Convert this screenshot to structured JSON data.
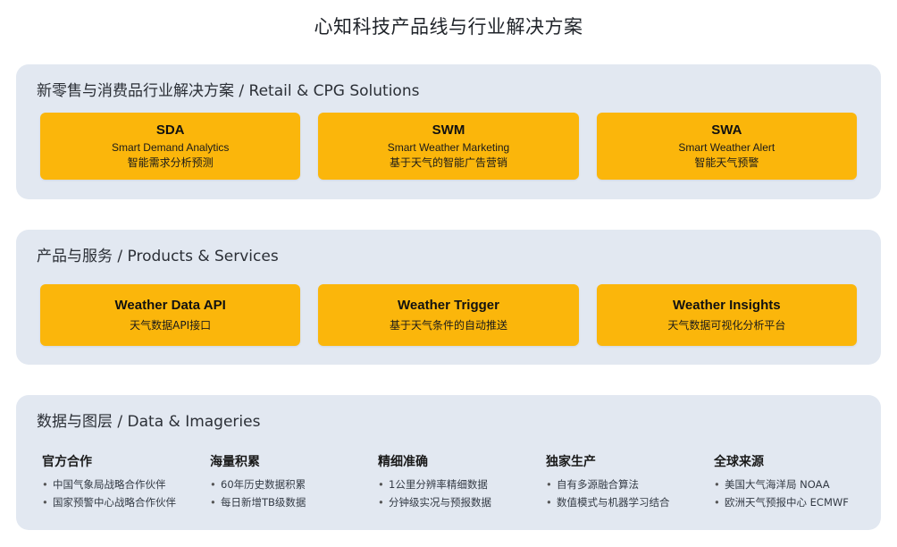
{
  "title": "心知科技产品线与行业解决方案",
  "sections": {
    "retail": {
      "title": "新零售与消费品行业解决方案 / Retail & CPG Solutions",
      "cards": [
        {
          "code": "SDA",
          "en": "Smart Demand Analytics",
          "zh": "智能需求分析预测"
        },
        {
          "code": "SWM",
          "en": "Smart Weather Marketing",
          "zh": "基于天气的智能广告营销"
        },
        {
          "code": "SWA",
          "en": "Smart Weather Alert",
          "zh": "智能天气预警"
        }
      ]
    },
    "products": {
      "title": "产品与服务 / Products & Services",
      "cards": [
        {
          "name": "Weather Data API",
          "desc": "天气数据API接口"
        },
        {
          "name": "Weather Trigger",
          "desc": "基于天气条件的自动推送"
        },
        {
          "name": "Weather Insights",
          "desc": "天气数据可视化分析平台"
        }
      ]
    },
    "data": {
      "title": "数据与图层 / Data & Imageries",
      "bullet": "•",
      "columns": [
        {
          "title": "官方合作",
          "items": [
            "中国气象局战略合作伙伴",
            "国家预警中心战略合作伙伴"
          ]
        },
        {
          "title": "海量积累",
          "items": [
            "60年历史数据积累",
            "每日新增TB级数据"
          ]
        },
        {
          "title": "精细准确",
          "items": [
            "1公里分辨率精细数据",
            "分钟级实况与预报数据"
          ]
        },
        {
          "title": "独家生产",
          "items": [
            "自有多源融合算法",
            "数值模式与机器学习结合"
          ]
        },
        {
          "title": "全球来源",
          "items": [
            "美国大气海洋局 NOAA",
            "欧洲天气预报中心 ECMWF"
          ]
        }
      ]
    }
  },
  "colors": {
    "card": "#fbb60b",
    "section_bg": "#e2e8f1"
  }
}
